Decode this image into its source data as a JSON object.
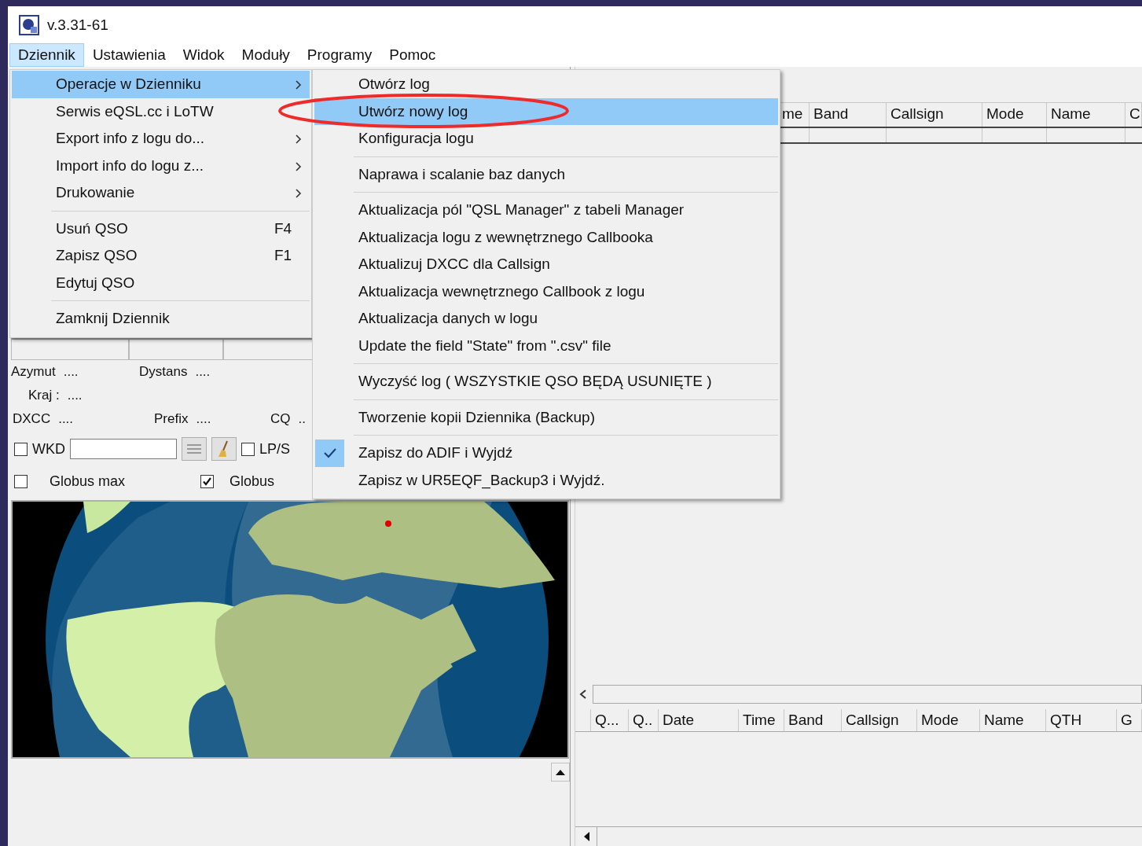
{
  "window": {
    "title": "v.3.31-61"
  },
  "menubar": [
    {
      "label": "Dziennik",
      "selected": true
    },
    {
      "label": "Ustawienia",
      "selected": false
    },
    {
      "label": "Widok",
      "selected": false
    },
    {
      "label": "Moduły",
      "selected": false
    },
    {
      "label": "Programy",
      "selected": false
    },
    {
      "label": "Pomoc",
      "selected": false
    }
  ],
  "main_menu": [
    {
      "kind": "item",
      "label": "Operacje w Dzienniku",
      "selected": true,
      "submenu": true
    },
    {
      "kind": "item",
      "label": "Serwis eQSL.cc i LoTW",
      "selected": false,
      "submenu": false
    },
    {
      "kind": "item",
      "label": "Export info z logu do...",
      "selected": false,
      "submenu": true
    },
    {
      "kind": "item",
      "label": "Import  info do logu z...",
      "selected": false,
      "submenu": true
    },
    {
      "kind": "item",
      "label": "Drukowanie",
      "selected": false,
      "submenu": true
    },
    {
      "kind": "separator"
    },
    {
      "kind": "item",
      "label": "Usuń QSO",
      "shortcut": "F4",
      "selected": false,
      "submenu": false
    },
    {
      "kind": "item",
      "label": "Zapisz QSO",
      "shortcut": "F1",
      "selected": false,
      "submenu": false
    },
    {
      "kind": "item",
      "label": "Edytuj QSO",
      "selected": false,
      "submenu": false
    },
    {
      "kind": "separator"
    },
    {
      "kind": "item",
      "label": "Zamknij Dziennik",
      "selected": false,
      "submenu": false
    }
  ],
  "submenu": [
    {
      "kind": "item",
      "label": "Otwórz log",
      "selected": false,
      "checked": false
    },
    {
      "kind": "item",
      "label": "Utwórz nowy log",
      "selected": true,
      "checked": false
    },
    {
      "kind": "item",
      "label": "Konfiguracja logu",
      "selected": false,
      "checked": false
    },
    {
      "kind": "separator"
    },
    {
      "kind": "item",
      "label": "Naprawa i scalanie baz danych",
      "selected": false,
      "checked": false
    },
    {
      "kind": "separator"
    },
    {
      "kind": "item",
      "label": "Aktualizacja pól \"QSL Manager\" z tabeli Manager",
      "selected": false,
      "checked": false
    },
    {
      "kind": "item",
      "label": "Aktualizacja logu z wewnętrznego Callbooka",
      "selected": false,
      "checked": false
    },
    {
      "kind": "item",
      "label": "Aktualizuj DXCC dla Callsign",
      "selected": false,
      "checked": false
    },
    {
      "kind": "item",
      "label": "Aktualizacja wewnętrznego Callbook z logu",
      "selected": false,
      "checked": false
    },
    {
      "kind": "item",
      "label": "Aktualizacja danych w logu",
      "selected": false,
      "checked": false
    },
    {
      "kind": "item",
      "label": "Update the field \"State\" from \".csv\" file",
      "selected": false,
      "checked": false
    },
    {
      "kind": "separator"
    },
    {
      "kind": "item",
      "label": "Wyczyść log ( WSZYSTKIE QSO BĘDĄ USUNIĘTE )",
      "selected": false,
      "checked": false
    },
    {
      "kind": "separator"
    },
    {
      "kind": "item",
      "label": "Tworzenie kopii Dziennika (Backup)",
      "selected": false,
      "checked": false
    },
    {
      "kind": "separator"
    },
    {
      "kind": "item",
      "label": "Zapisz do ADIF i Wyjdź",
      "selected": false,
      "checked": true
    },
    {
      "kind": "item",
      "label": "Zapisz w UR5EQF_Backup3 i Wyjdź.",
      "selected": false,
      "checked": false
    }
  ],
  "info_rows": [
    [
      {
        "label": "Azymut",
        "value": "...."
      },
      {
        "label": "Dystans",
        "value": "...."
      }
    ],
    [
      {
        "label": "Kraj :",
        "value": "...."
      }
    ],
    [
      {
        "label": "DXCC",
        "value": "...."
      },
      {
        "label": "Prefix",
        "value": "...."
      },
      {
        "label": "CQ",
        "value": ".."
      }
    ]
  ],
  "wkd_row": {
    "checkbox": {
      "label": "WKD",
      "checked": false
    },
    "lp_checkbox": {
      "label": "LP/S",
      "checked": false
    }
  },
  "globe_row": [
    {
      "label": "Globus max",
      "checked": false
    },
    {
      "label": "Globus",
      "checked": true
    }
  ],
  "top_table": {
    "columns": [
      "me",
      "Band",
      "Callsign",
      "Mode",
      "Name",
      "C"
    ]
  },
  "log_table": {
    "columns": [
      "Q...",
      "Q..",
      "Date",
      "Time",
      "Band",
      "Callsign",
      "Mode",
      "Name",
      "QTH",
      "G"
    ]
  }
}
